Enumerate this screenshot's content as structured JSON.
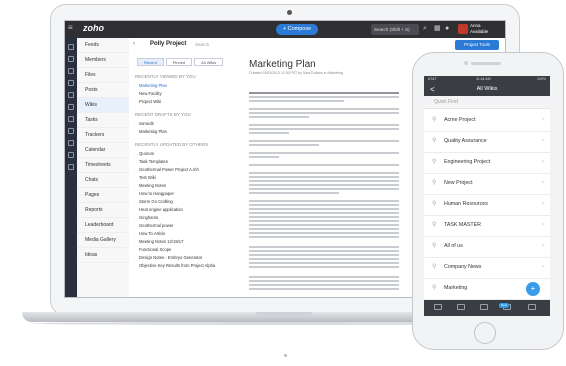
{
  "topbar": {
    "logo": "zoho",
    "compose_label": "+ Compose",
    "search_placeholder": "Search (Shift + S)",
    "user_name": "Anna",
    "user_status": "Available"
  },
  "nav": {
    "items": [
      "Feeds",
      "Members",
      "Files",
      "Posts",
      "Wikis",
      "Tasks",
      "Trackers",
      "Calendar",
      "Timesheets",
      "Chats",
      "Pages",
      "Reports",
      "Leaderboard",
      "Media Gallery",
      "Ideas"
    ]
  },
  "project": {
    "title": "Polly Project",
    "search_label": "Search",
    "tools_label": "Project Tools"
  },
  "wikilist": {
    "tabs": [
      "Recent",
      "Pinned",
      "All Wikis"
    ],
    "sec_viewed": "RECENTLY VIEWED BY YOU",
    "viewed": [
      "Marketing Plan",
      "New Facility",
      "Project Wiki"
    ],
    "sec_created": "RECENT DRAFTS BY YOU",
    "created": [
      "somedit",
      "Marketing Plan"
    ],
    "sec_updated": "RECENTLY UPDATED BY OTHERS",
    "updated": [
      "Quorum",
      "Task Templates",
      "Geothermal Power Project A.mh",
      "Test Wiki",
      "Meeting Notes",
      "How to Hangpaper",
      "Storm Go Crafting",
      "Heat engine application",
      "Ginghams",
      "Geothermal power",
      "How To Article",
      "Meeting Notes 12/19/17",
      "Functional Scope",
      "Design Notes - Embryo Generator",
      "Objective Key Results from Project Alpha"
    ]
  },
  "doc": {
    "title": "Marketing Plan",
    "meta": "Created 03/03/2013 11:36 PST by Sara Dollans in Marketing"
  },
  "phone": {
    "carrier": "AT&T",
    "time": "11:44 AM",
    "battery": "100%",
    "header": "All Wikis",
    "back_label": "<",
    "search_placeholder": "Quick Find",
    "items": [
      "Acme Project",
      "Quality Assurance",
      "Engineering Project",
      "New Project",
      "Human Resources",
      "TASK MASTER",
      "All of us",
      "Company News",
      "Marketing"
    ],
    "fab_label": "+",
    "tab_badge": "New"
  }
}
